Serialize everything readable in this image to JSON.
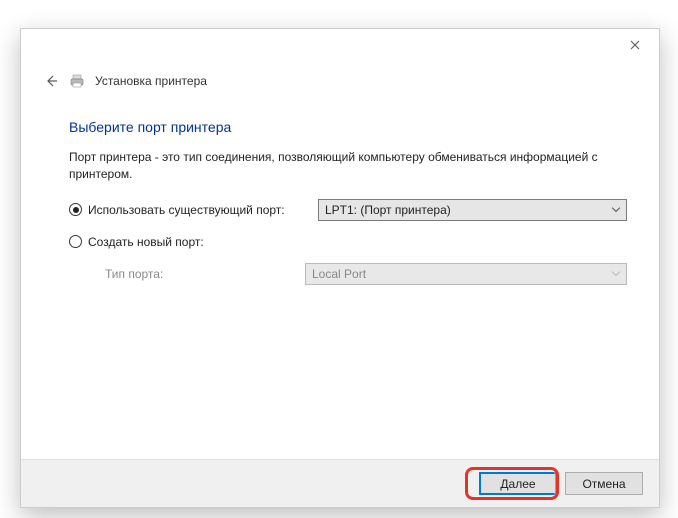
{
  "header": {
    "wizard_title": "Установка принтера"
  },
  "page": {
    "heading": "Выберите порт принтера",
    "description": "Порт принтера - это тип соединения, позволяющий компьютеру обмениваться информацией с принтером."
  },
  "options": {
    "existing": {
      "label": "Использовать существующий порт:",
      "value": "LPT1: (Порт принтера)",
      "checked": true
    },
    "create": {
      "label": "Создать новый порт:",
      "sub_label": "Тип порта:",
      "value": "Local Port",
      "checked": false
    }
  },
  "footer": {
    "next": "Далее",
    "cancel": "Отмена"
  }
}
